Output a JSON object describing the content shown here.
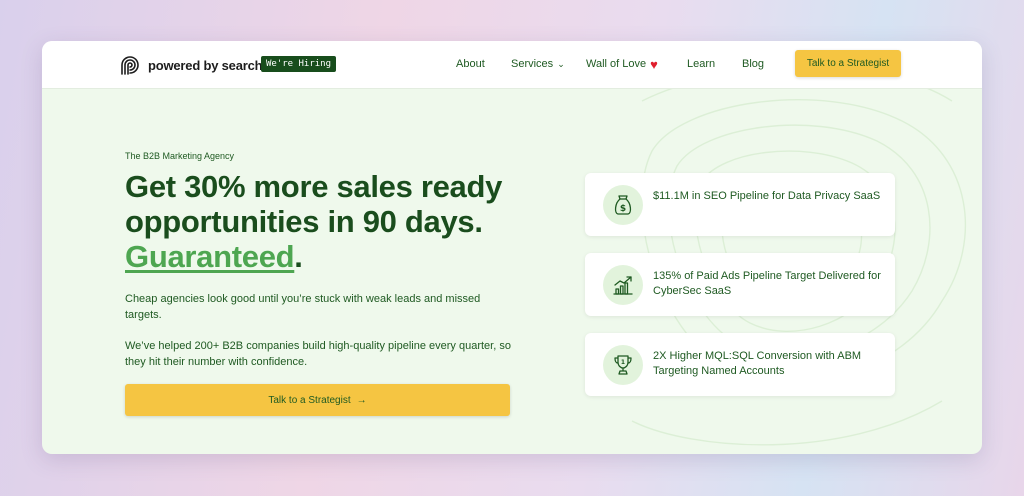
{
  "brand": {
    "name": "powered by search",
    "hiring_badge": "We're Hiring"
  },
  "nav": {
    "items": [
      {
        "label": "About"
      },
      {
        "label": "Services",
        "icon": "chevron-down-icon"
      },
      {
        "label": "Wall of Love",
        "icon": "heart-icon"
      },
      {
        "label": "Learn"
      },
      {
        "label": "Blog"
      }
    ],
    "cta": "Talk to a Strategist"
  },
  "hero": {
    "eyebrow": "The B2B Marketing Agency",
    "headline_main": "Get 30% more sales ready opportunities in 90 days.",
    "headline_accent": "Guaranteed",
    "headline_end": ".",
    "paragraph_1": "Cheap agencies look good until you’re stuck with weak leads and missed targets.",
    "paragraph_2": "We’ve helped 200+ B2B companies build high-quality pipeline every quarter, so they hit their number with confidence.",
    "cta": "Talk to a Strategist",
    "cta_arrow": "→"
  },
  "stats": [
    {
      "text": "$11.1M in SEO Pipeline for Data Privacy SaaS",
      "icon": "money-bag-icon"
    },
    {
      "text": "135% of Paid Ads Pipeline Target Delivered for CyberSec SaaS",
      "icon": "growth-chart-icon"
    },
    {
      "text": "2X Higher MQL:SQL Conversion with ABM Targeting Named Accounts",
      "icon": "trophy-icon"
    }
  ],
  "colors": {
    "primary_green": "#1a4d1d",
    "accent_green": "#4ea651",
    "cta_yellow": "#f5c542",
    "hero_background": "#eff9ec",
    "heart_red": "#e01f2d"
  }
}
